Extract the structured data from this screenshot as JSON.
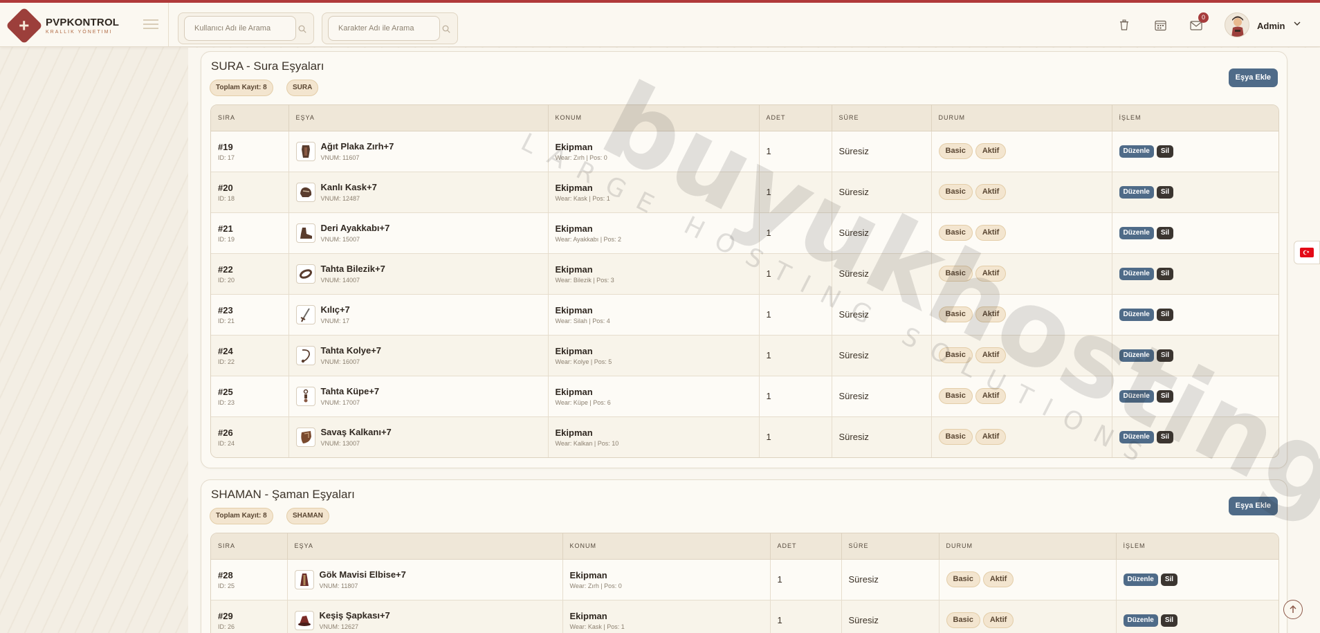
{
  "brand": {
    "title": "PVPKONTROL",
    "subtitle": "KRALLIK YÖNETIMI"
  },
  "search": {
    "user_placeholder": "Kullanıcı Adı ile Arama",
    "character_placeholder": "Karakter Adı ile Arama"
  },
  "header": {
    "notification_count": "0",
    "user_name": "Admin"
  },
  "colors": {
    "accent": "#9c3f3b",
    "primary_button": "#4f6b88",
    "danger_button": "#3b3530",
    "badge_bg": "#f3e5cf"
  },
  "watermark": {
    "main": "buyukhosting",
    "sub": "LARGE HOSTING SOLUTIONS"
  },
  "columns": [
    "SIRA",
    "EŞYA",
    "KONUM",
    "ADET",
    "SÜRE",
    "DURUM",
    "İŞLEM"
  ],
  "sections": [
    {
      "title": "SURA - Sura Eşyaları",
      "count_label": "Toplam Kayıt: 8",
      "class_label": "SURA",
      "add_label": "Eşya Ekle",
      "rows": [
        {
          "sira": "#19",
          "id": "ID: 17",
          "name": "Ağıt Plaka Zırh+7",
          "vnum": "VNUM: 11607",
          "konum": "Ekipman",
          "wear": "Wear: Zırh | Pos: 0",
          "adet": "1",
          "sure": "Süresiz",
          "type": "Basic",
          "status": "Aktif",
          "edit": "Düzenle",
          "del": "Sil",
          "icon": "armor-icon"
        },
        {
          "sira": "#20",
          "id": "ID: 18",
          "name": "Kanlı Kask+7",
          "vnum": "VNUM: 12487",
          "konum": "Ekipman",
          "wear": "Wear: Kask | Pos: 1",
          "adet": "1",
          "sure": "Süresiz",
          "type": "Basic",
          "status": "Aktif",
          "edit": "Düzenle",
          "del": "Sil",
          "icon": "helmet-icon"
        },
        {
          "sira": "#21",
          "id": "ID: 19",
          "name": "Deri Ayakkabı+7",
          "vnum": "VNUM: 15007",
          "konum": "Ekipman",
          "wear": "Wear: Ayakkabı | Pos: 2",
          "adet": "1",
          "sure": "Süresiz",
          "type": "Basic",
          "status": "Aktif",
          "edit": "Düzenle",
          "del": "Sil",
          "icon": "boots-icon"
        },
        {
          "sira": "#22",
          "id": "ID: 20",
          "name": "Tahta Bilezik+7",
          "vnum": "VNUM: 14007",
          "konum": "Ekipman",
          "wear": "Wear: Bilezik | Pos: 3",
          "adet": "1",
          "sure": "Süresiz",
          "type": "Basic",
          "status": "Aktif",
          "edit": "Düzenle",
          "del": "Sil",
          "icon": "bracelet-icon"
        },
        {
          "sira": "#23",
          "id": "ID: 21",
          "name": "Kılıç+7",
          "vnum": "VNUM: 17",
          "konum": "Ekipman",
          "wear": "Wear: Silah | Pos: 4",
          "adet": "1",
          "sure": "Süresiz",
          "type": "Basic",
          "status": "Aktif",
          "edit": "Düzenle",
          "del": "Sil",
          "icon": "sword-icon"
        },
        {
          "sira": "#24",
          "id": "ID: 22",
          "name": "Tahta Kolye+7",
          "vnum": "VNUM: 16007",
          "konum": "Ekipman",
          "wear": "Wear: Kolye | Pos: 5",
          "adet": "1",
          "sure": "Süresiz",
          "type": "Basic",
          "status": "Aktif",
          "edit": "Düzenle",
          "del": "Sil",
          "icon": "necklace-icon"
        },
        {
          "sira": "#25",
          "id": "ID: 23",
          "name": "Tahta Küpe+7",
          "vnum": "VNUM: 17007",
          "konum": "Ekipman",
          "wear": "Wear: Küpe | Pos: 6",
          "adet": "1",
          "sure": "Süresiz",
          "type": "Basic",
          "status": "Aktif",
          "edit": "Düzenle",
          "del": "Sil",
          "icon": "earring-icon"
        },
        {
          "sira": "#26",
          "id": "ID: 24",
          "name": "Savaş Kalkanı+7",
          "vnum": "VNUM: 13007",
          "konum": "Ekipman",
          "wear": "Wear: Kalkan | Pos: 10",
          "adet": "1",
          "sure": "Süresiz",
          "type": "Basic",
          "status": "Aktif",
          "edit": "Düzenle",
          "del": "Sil",
          "icon": "shield-icon"
        }
      ]
    },
    {
      "title": "SHAMAN - Şaman Eşyaları",
      "count_label": "Toplam Kayıt: 8",
      "class_label": "SHAMAN",
      "add_label": "Eşya Ekle",
      "rows": [
        {
          "sira": "#28",
          "id": "ID: 25",
          "name": "Gök Mavisi Elbise+7",
          "vnum": "VNUM: 11807",
          "konum": "Ekipman",
          "wear": "Wear: Zırh | Pos: 0",
          "adet": "1",
          "sure": "Süresiz",
          "type": "Basic",
          "status": "Aktif",
          "edit": "Düzenle",
          "del": "Sil",
          "icon": "robe-icon"
        },
        {
          "sira": "#29",
          "id": "ID: 26",
          "name": "Keşiş Şapkası+7",
          "vnum": "VNUM: 12627",
          "konum": "Ekipman",
          "wear": "Wear: Kask | Pos: 1",
          "adet": "1",
          "sure": "Süresiz",
          "type": "Basic",
          "status": "Aktif",
          "edit": "Düzenle",
          "del": "Sil",
          "icon": "hat-icon"
        }
      ]
    }
  ]
}
